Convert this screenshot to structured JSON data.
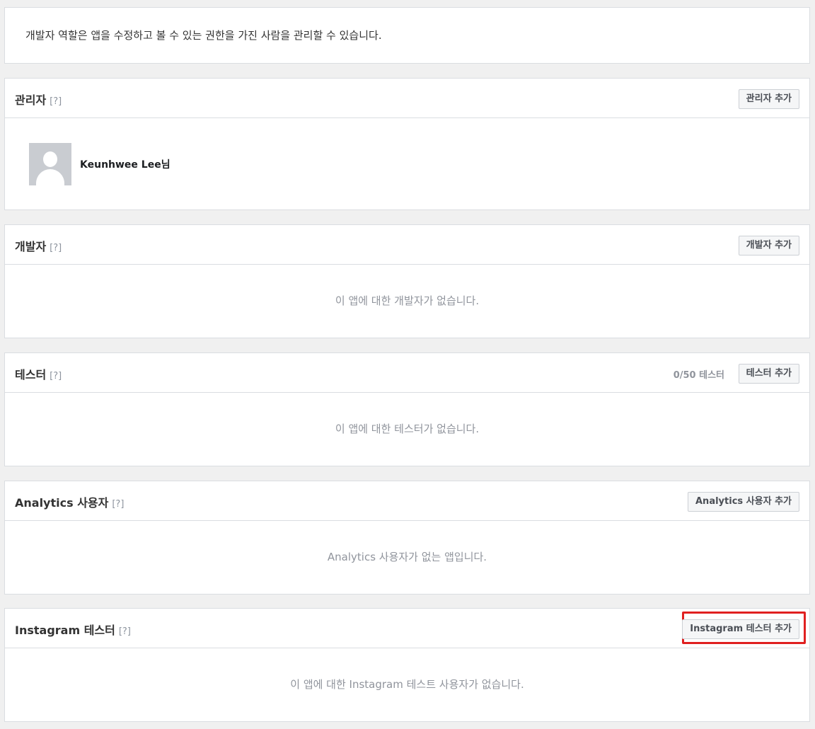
{
  "intro": {
    "text": "개발자 역할은 앱을 수정하고 볼 수 있는 권한을 가진 사람을 관리할 수 있습니다."
  },
  "sections": {
    "admins": {
      "title": "관리자",
      "help": "[?]",
      "add_label": "관리자 추가",
      "members": [
        {
          "name": "Keunhwee Lee님"
        }
      ]
    },
    "developers": {
      "title": "개발자",
      "help": "[?]",
      "add_label": "개발자 추가",
      "empty_text": "이 앱에 대한 개발자가 없습니다."
    },
    "testers": {
      "title": "테스터",
      "help": "[?]",
      "count": "0/50 테스터",
      "add_label": "테스터 추가",
      "empty_text": "이 앱에 대한 테스터가 없습니다."
    },
    "analytics": {
      "title": "Analytics 사용자",
      "help": "[?]",
      "add_label": "Analytics 사용자 추가",
      "empty_text": "Analytics 사용자가 없는 앱입니다."
    },
    "instagram": {
      "title": "Instagram 테스터",
      "help": "[?]",
      "add_label": "Instagram 테스터 추가",
      "empty_text": "이 앱에 대한 Instagram 테스트 사용자가 없습니다."
    }
  },
  "colors": {
    "page_bg": "#f0f0f0",
    "panel_border": "#dadde1",
    "highlight": "#e02020"
  }
}
